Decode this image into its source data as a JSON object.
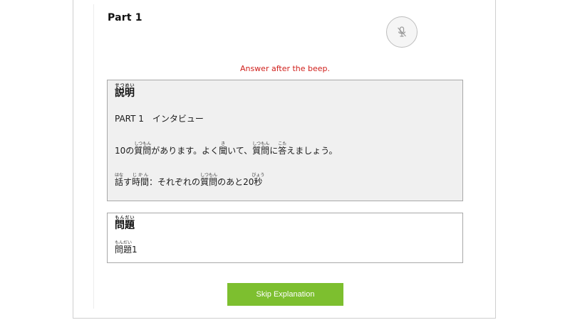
{
  "header": {
    "part_title": "Part 1",
    "mic_icon": "microphone-off-icon"
  },
  "instruction": "Answer after the beep.",
  "explanation": {
    "heading": {
      "base": "説明",
      "ruby": "せつめい"
    },
    "part_line": "PART 1　インタビュー",
    "line1": {
      "t1": "10の",
      "w1": {
        "base": "質問",
        "ruby": "しつもん"
      },
      "t2": "があります。よく",
      "w2": {
        "base": "聞",
        "ruby": "き"
      },
      "t3": "いて、",
      "w3": {
        "base": "質問",
        "ruby": "しつもん"
      },
      "t4": "に",
      "w4": {
        "base": "答",
        "ruby": "こた"
      },
      "t5": "えましょう。"
    },
    "line2": {
      "w1": {
        "base": "話",
        "ruby": "はな"
      },
      "t1": "す",
      "w2": {
        "base": "時間",
        "ruby": "じかん"
      },
      "t2": "：それぞれの",
      "w3": {
        "base": "質問",
        "ruby": "しつもん"
      },
      "t3": "のあと20",
      "w4": {
        "base": "秒",
        "ruby": "びょう"
      }
    }
  },
  "question": {
    "heading": {
      "base": "問題",
      "ruby": "もんだい"
    },
    "item": {
      "base": "問題",
      "ruby": "もんだい",
      "suffix": "1"
    }
  },
  "skip_button_label": "Skip Explanation",
  "colors": {
    "instruction": "#d0201c",
    "skip_button": "#7dbf2f",
    "explanation_bg": "#f0f0f0"
  }
}
